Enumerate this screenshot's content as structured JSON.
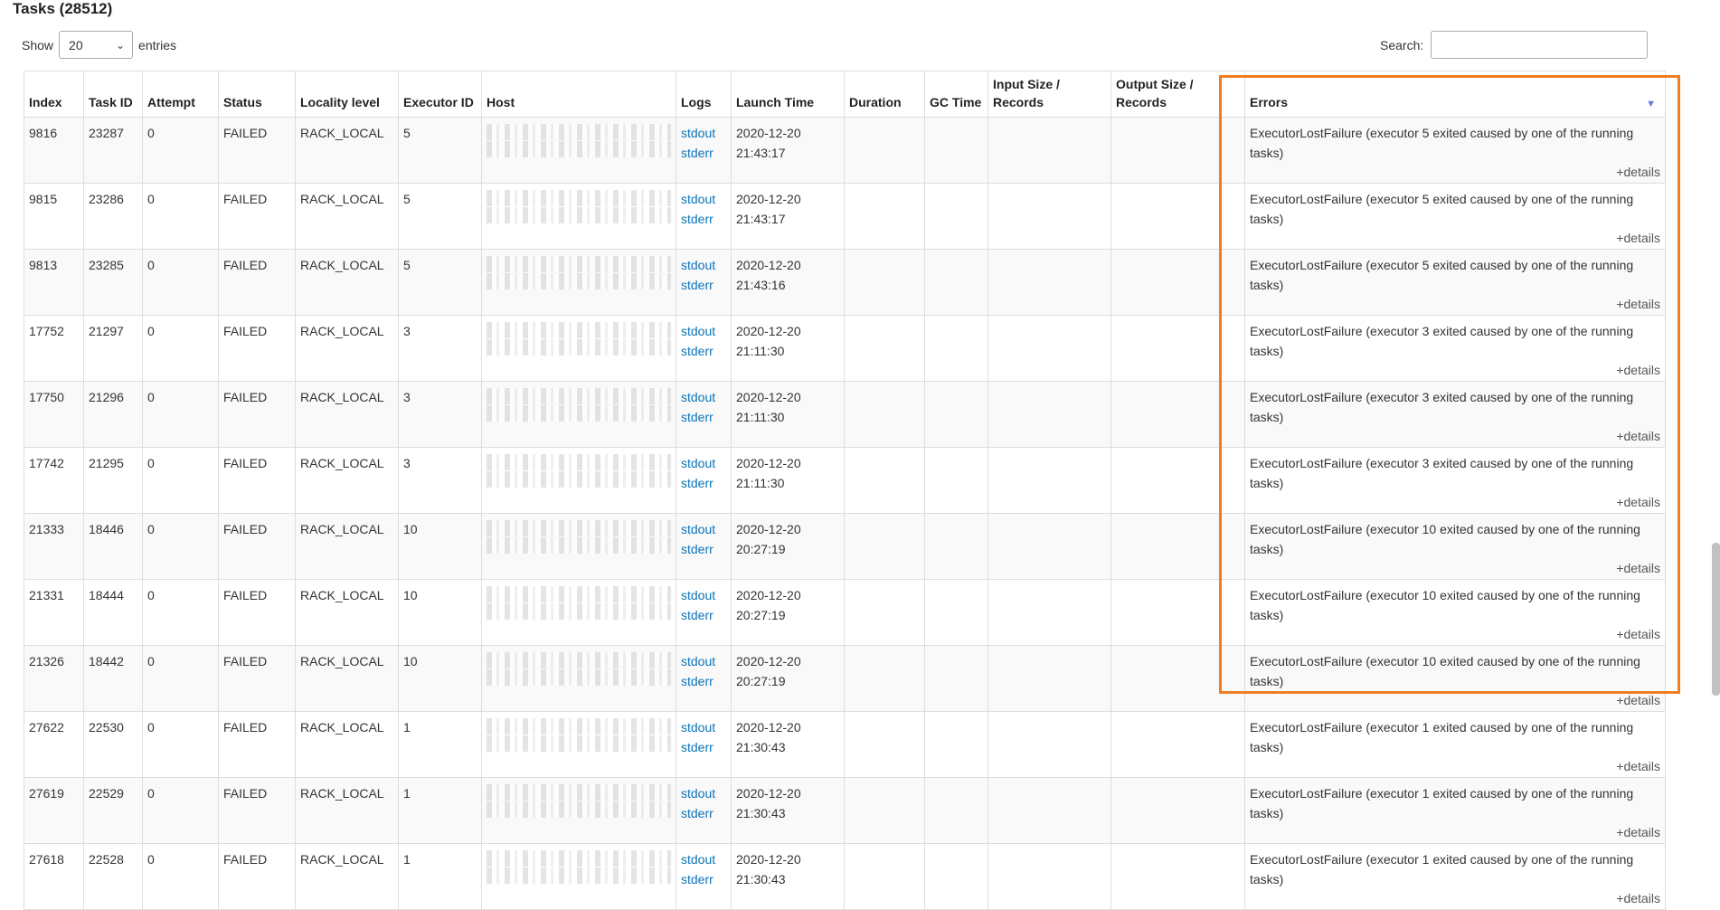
{
  "page_title": "Tasks (28512)",
  "length_control": {
    "show_label": "Show",
    "selected": "20",
    "entries_label": "entries"
  },
  "search": {
    "label": "Search:",
    "value": "",
    "placeholder": ""
  },
  "columns": [
    "Index",
    "Task ID",
    "Attempt",
    "Status",
    "Locality level",
    "Executor ID",
    "Host",
    "Logs",
    "Launch Time",
    "Duration",
    "GC Time",
    "Input Size / Records",
    "Output Size / Records",
    "Errors"
  ],
  "rows": [
    {
      "index": "9816",
      "task_id": "23287",
      "attempt": "0",
      "status": "FAILED",
      "locality": "RACK_LOCAL",
      "executor": "5",
      "logs": [
        "stdout",
        "stderr"
      ],
      "launch_date": "2020-12-20",
      "launch_time": "21:43:17",
      "duration": "",
      "gc_time": "",
      "input": "",
      "output": "",
      "error": "ExecutorLostFailure (executor 5 exited caused by one of the running tasks)",
      "details": "+details"
    },
    {
      "index": "9815",
      "task_id": "23286",
      "attempt": "0",
      "status": "FAILED",
      "locality": "RACK_LOCAL",
      "executor": "5",
      "logs": [
        "stdout",
        "stderr"
      ],
      "launch_date": "2020-12-20",
      "launch_time": "21:43:17",
      "duration": "",
      "gc_time": "",
      "input": "",
      "output": "",
      "error": "ExecutorLostFailure (executor 5 exited caused by one of the running tasks)",
      "details": "+details"
    },
    {
      "index": "9813",
      "task_id": "23285",
      "attempt": "0",
      "status": "FAILED",
      "locality": "RACK_LOCAL",
      "executor": "5",
      "logs": [
        "stdout",
        "stderr"
      ],
      "launch_date": "2020-12-20",
      "launch_time": "21:43:16",
      "duration": "",
      "gc_time": "",
      "input": "",
      "output": "",
      "error": "ExecutorLostFailure (executor 5 exited caused by one of the running tasks)",
      "details": "+details"
    },
    {
      "index": "17752",
      "task_id": "21297",
      "attempt": "0",
      "status": "FAILED",
      "locality": "RACK_LOCAL",
      "executor": "3",
      "logs": [
        "stdout",
        "stderr"
      ],
      "launch_date": "2020-12-20",
      "launch_time": "21:11:30",
      "duration": "",
      "gc_time": "",
      "input": "",
      "output": "",
      "error": "ExecutorLostFailure (executor 3 exited caused by one of the running tasks)",
      "details": "+details"
    },
    {
      "index": "17750",
      "task_id": "21296",
      "attempt": "0",
      "status": "FAILED",
      "locality": "RACK_LOCAL",
      "executor": "3",
      "logs": [
        "stdout",
        "stderr"
      ],
      "launch_date": "2020-12-20",
      "launch_time": "21:11:30",
      "duration": "",
      "gc_time": "",
      "input": "",
      "output": "",
      "error": "ExecutorLostFailure (executor 3 exited caused by one of the running tasks)",
      "details": "+details"
    },
    {
      "index": "17742",
      "task_id": "21295",
      "attempt": "0",
      "status": "FAILED",
      "locality": "RACK_LOCAL",
      "executor": "3",
      "logs": [
        "stdout",
        "stderr"
      ],
      "launch_date": "2020-12-20",
      "launch_time": "21:11:30",
      "duration": "",
      "gc_time": "",
      "input": "",
      "output": "",
      "error": "ExecutorLostFailure (executor 3 exited caused by one of the running tasks)",
      "details": "+details"
    },
    {
      "index": "21333",
      "task_id": "18446",
      "attempt": "0",
      "status": "FAILED",
      "locality": "RACK_LOCAL",
      "executor": "10",
      "logs": [
        "stdout",
        "stderr"
      ],
      "launch_date": "2020-12-20",
      "launch_time": "20:27:19",
      "duration": "",
      "gc_time": "",
      "input": "",
      "output": "",
      "error": "ExecutorLostFailure (executor 10 exited caused by one of the running tasks)",
      "details": "+details"
    },
    {
      "index": "21331",
      "task_id": "18444",
      "attempt": "0",
      "status": "FAILED",
      "locality": "RACK_LOCAL",
      "executor": "10",
      "logs": [
        "stdout",
        "stderr"
      ],
      "launch_date": "2020-12-20",
      "launch_time": "20:27:19",
      "duration": "",
      "gc_time": "",
      "input": "",
      "output": "",
      "error": "ExecutorLostFailure (executor 10 exited caused by one of the running tasks)",
      "details": "+details"
    },
    {
      "index": "21326",
      "task_id": "18442",
      "attempt": "0",
      "status": "FAILED",
      "locality": "RACK_LOCAL",
      "executor": "10",
      "logs": [
        "stdout",
        "stderr"
      ],
      "launch_date": "2020-12-20",
      "launch_time": "20:27:19",
      "duration": "",
      "gc_time": "",
      "input": "",
      "output": "",
      "error": "ExecutorLostFailure (executor 10 exited caused by one of the running tasks)",
      "details": "+details"
    },
    {
      "index": "27622",
      "task_id": "22530",
      "attempt": "0",
      "status": "FAILED",
      "locality": "RACK_LOCAL",
      "executor": "1",
      "logs": [
        "stdout",
        "stderr"
      ],
      "launch_date": "2020-12-20",
      "launch_time": "21:30:43",
      "duration": "",
      "gc_time": "",
      "input": "",
      "output": "",
      "error": "ExecutorLostFailure (executor 1 exited caused by one of the running tasks)",
      "details": "+details"
    },
    {
      "index": "27619",
      "task_id": "22529",
      "attempt": "0",
      "status": "FAILED",
      "locality": "RACK_LOCAL",
      "executor": "1",
      "logs": [
        "stdout",
        "stderr"
      ],
      "launch_date": "2020-12-20",
      "launch_time": "21:30:43",
      "duration": "",
      "gc_time": "",
      "input": "",
      "output": "",
      "error": "ExecutorLostFailure (executor 1 exited caused by one of the running tasks)",
      "details": "+details"
    },
    {
      "index": "27618",
      "task_id": "22528",
      "attempt": "0",
      "status": "FAILED",
      "locality": "RACK_LOCAL",
      "executor": "1",
      "logs": [
        "stdout",
        "stderr"
      ],
      "launch_date": "2020-12-20",
      "launch_time": "21:30:43",
      "duration": "",
      "gc_time": "",
      "input": "",
      "output": "",
      "error": "ExecutorLostFailure (executor 1 exited caused by one of the running tasks)",
      "details": "+details"
    }
  ],
  "colors": {
    "link": "#0e73b8",
    "highlight": "#f07d22",
    "sort_arrow": "#5b7fdc"
  }
}
